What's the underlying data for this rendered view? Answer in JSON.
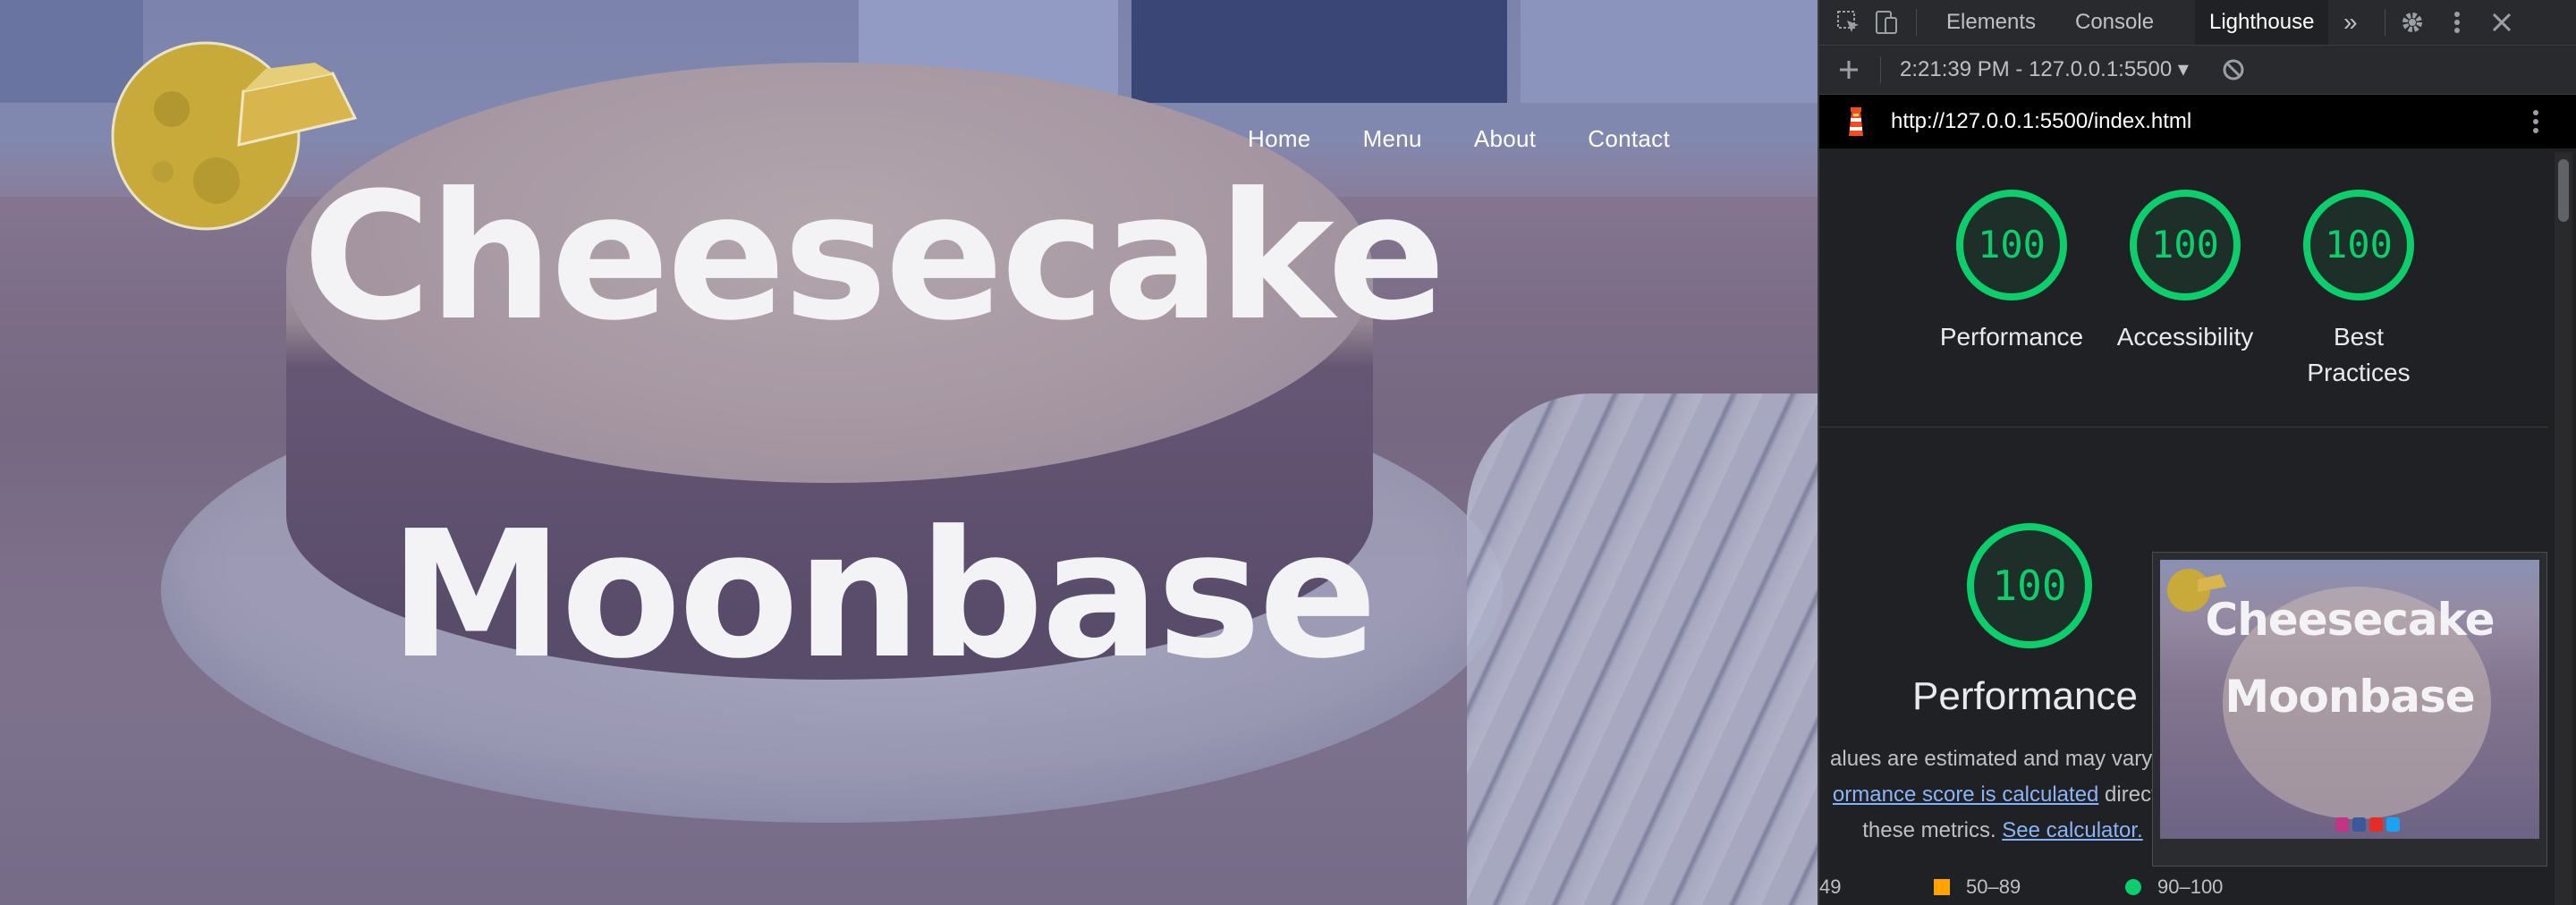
{
  "website": {
    "nav": [
      "Home",
      "Menu",
      "About",
      "Contact"
    ],
    "hero_line1": "Cheesecake",
    "hero_line2": "Moonbase"
  },
  "devtools": {
    "tabs": [
      "Elements",
      "Console",
      "Lighthouse"
    ],
    "active_tab": "Lighthouse",
    "more_tabs_label": "»",
    "report_selector": "2:21:39 PM - 127.0.0.1:5500 ▾",
    "url": "http://127.0.0.1:5500/index.html",
    "scores": [
      {
        "score": "100",
        "label": "Performance"
      },
      {
        "score": "100",
        "label": "Accessibility"
      },
      {
        "score": "100",
        "label": "Best Practices"
      }
    ],
    "performance": {
      "score": "100",
      "title": "Performance",
      "desc_line1": "alues are estimated and may vary. T",
      "desc_link1": "ormance score is calculated",
      "desc_line2_tail": " directly",
      "desc_line3_pre": "these metrics. ",
      "desc_link2": "See calculator."
    },
    "legend": [
      "49",
      "50–89",
      "90–100"
    ],
    "colors": {
      "pass": "#0cce6b",
      "average": "#ffa400",
      "fail": "#ff4e42"
    },
    "thumbnail": {
      "line1": "Cheesecake",
      "line2": "Moonbase"
    }
  }
}
